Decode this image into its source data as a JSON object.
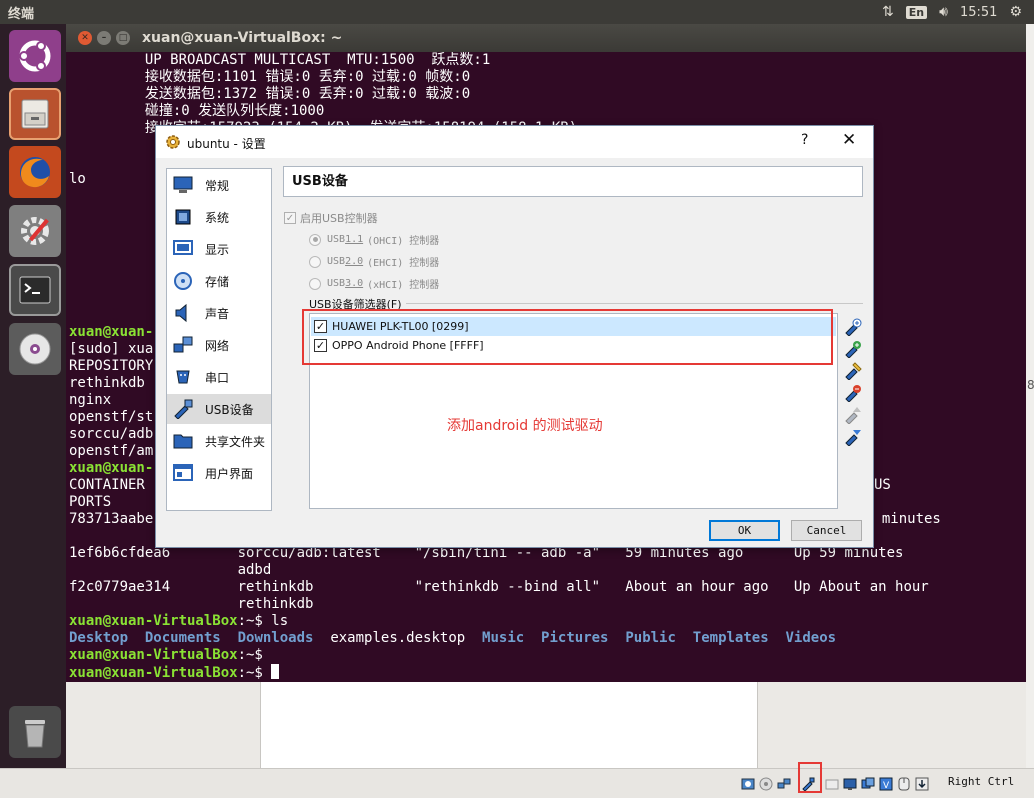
{
  "topbar": {
    "title": "终端",
    "lang": "En",
    "time": "15:51"
  },
  "terminal": {
    "title": "xuan@xuan-VirtualBox: ~",
    "lines": [
      "         UP BROADCAST MULTICAST  MTU:1500  跃点数:1",
      "         接收数据包:1101 错误:0 丢弃:0 过载:0 帧数:0",
      "         发送数据包:1372 错误:0 丢弃:0 过载:0 载波:0",
      "         碰撞:0 发送队列长度:1000",
      "         接收字节:157923 (154.2 KB)  发送字节:158194 (158.1 KB)"
    ],
    "lo": "lo",
    "left_fragments": [
      {
        "text": "xuan@xuan-",
        "kind": "prompt"
      },
      {
        "text": "[sudo] xua",
        "kind": "plain"
      },
      {
        "text": "REPOSITORY",
        "kind": "plain"
      },
      {
        "text": "rethinkdb",
        "kind": "plain"
      },
      {
        "text": "nginx",
        "kind": "plain"
      },
      {
        "text": "openstf/st",
        "kind": "plain"
      },
      {
        "text": "sorccu/adb",
        "kind": "plain"
      },
      {
        "text": "openstf/am",
        "kind": "plain"
      },
      {
        "text": "xuan@xuan-",
        "kind": "prompt"
      },
      {
        "text": "CONTAINER",
        "kind": "plain"
      },
      {
        "text": "PORTS",
        "kind": "plain"
      },
      {
        "text": "783713aabe",
        "kind": "plain"
      }
    ],
    "right_fragments": {
      "us": "US",
      "minutes": "9 minutes"
    },
    "docker_rows": [
      "1ef6b6cfdea6        sorccu/adb:latest    \"/sbin/tini -- adb -a\"   59 minutes ago      Up 59 minutes",
      "                    adbd",
      "f2c0779ae314        rethinkdb            \"rethinkdb --bind all\"   About an hour ago   Up About an hour",
      "                    rethinkdb"
    ],
    "prompt": "xuan@xuan-VirtualBox",
    "prompt_suffix": ":~$ ",
    "cmd_ls": "ls",
    "ls_output": [
      {
        "name": "Desktop",
        "dir": true
      },
      {
        "name": "Documents",
        "dir": true
      },
      {
        "name": "Downloads",
        "dir": true
      },
      {
        "name": "examples.desktop",
        "dir": false
      },
      {
        "name": "Music",
        "dir": true
      },
      {
        "name": "Pictures",
        "dir": true
      },
      {
        "name": "Public",
        "dir": true
      },
      {
        "name": "Templates",
        "dir": true
      },
      {
        "name": "Videos",
        "dir": true
      }
    ]
  },
  "dialog": {
    "title": "ubuntu - 设置",
    "help": "?",
    "close": "✕",
    "categories": [
      {
        "label": "常规",
        "icon": "monitor-general-icon"
      },
      {
        "label": "系统",
        "icon": "chip-icon"
      },
      {
        "label": "显示",
        "icon": "display-icon"
      },
      {
        "label": "存储",
        "icon": "disk-icon"
      },
      {
        "label": "声音",
        "icon": "speaker-icon"
      },
      {
        "label": "网络",
        "icon": "network-icon"
      },
      {
        "label": "串口",
        "icon": "serial-port-icon"
      },
      {
        "label": "USB设备",
        "icon": "usb-icon",
        "selected": true
      },
      {
        "label": "共享文件夹",
        "icon": "folder-icon"
      },
      {
        "label": "用户界面",
        "icon": "window-icon"
      }
    ],
    "section_title": "USB设备",
    "enable_usb": "启用USB控制器",
    "radios": [
      {
        "prefix": "USB ",
        "version": "1.1",
        "label": "(OHCI) 控制器",
        "checked": true
      },
      {
        "prefix": "USB ",
        "version": "2.0",
        "label": "(EHCI) 控制器",
        "checked": false
      },
      {
        "prefix": "USB ",
        "version": "3.0",
        "label": "(xHCI) 控制器",
        "checked": false
      }
    ],
    "filter_label": "USB设备筛选器(F)",
    "filters": [
      {
        "label": "HUAWEI PLK-TL00 [0299]",
        "checked": true,
        "selected": true
      },
      {
        "label": "OPPO Android Phone [FFFF]",
        "checked": true,
        "selected": false
      }
    ],
    "annotation": "添加android 的测试驱动",
    "ok": "OK",
    "cancel": "Cancel"
  },
  "status": {
    "host_key": "Right Ctrl"
  },
  "right_digit": "8"
}
